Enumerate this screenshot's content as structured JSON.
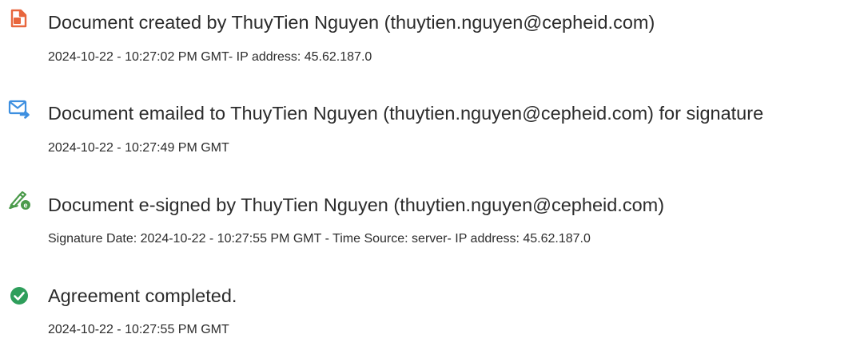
{
  "events": [
    {
      "icon": "document-created-icon",
      "title": "Document created by ThuyTien Nguyen (thuytien.nguyen@cepheid.com)",
      "detail": "2024-10-22 - 10:27:02 PM GMT- IP address: 45.62.187.0"
    },
    {
      "icon": "email-sent-icon",
      "title": "Document emailed to ThuyTien Nguyen (thuytien.nguyen@cepheid.com) for signature",
      "detail": "2024-10-22 - 10:27:49 PM GMT"
    },
    {
      "icon": "e-sign-pen-icon",
      "title": "Document e-signed by ThuyTien Nguyen (thuytien.nguyen@cepheid.com)",
      "detail": "Signature Date: 2024-10-22 - 10:27:55 PM GMT - Time Source: server- IP address: 45.62.187.0"
    },
    {
      "icon": "check-circle-icon",
      "title": "Agreement completed.",
      "detail": "2024-10-22 - 10:27:55 PM GMT"
    }
  ],
  "colors": {
    "created_icon": "#e8663d",
    "email_icon": "#3d8fe0",
    "esign_icon": "#4a9a4a",
    "completed_icon": "#2e9e5b",
    "text": "#2c2c2c"
  }
}
